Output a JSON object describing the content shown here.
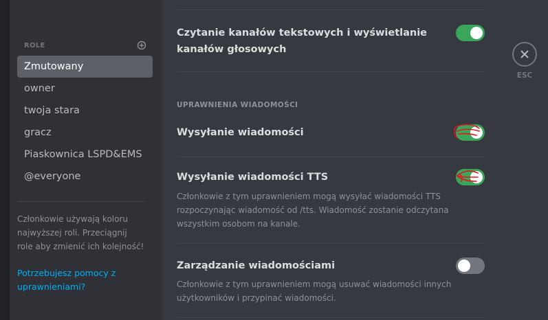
{
  "sidebar": {
    "roles_title": "ROLE",
    "add_role_icon": "plus-circle-icon",
    "roles": [
      {
        "label": "Zmutowany",
        "selected": true
      },
      {
        "label": "owner"
      },
      {
        "label": "twoja stara"
      },
      {
        "label": "gracz"
      },
      {
        "label": "Piaskownica LSPD&EMS"
      },
      {
        "label": "@everyone"
      }
    ],
    "note": "Członkowie używają koloru najwyższej roli. Przeciągnij role aby zmienić ich kolejność!",
    "help_link": "Potrzebujesz pomocy z uprawnieniami?"
  },
  "permissions": {
    "read_channels": {
      "title": "Czytanie kanałów tekstowych i wyświetlanie kanałów głosowych",
      "enabled": true
    },
    "section_messages": "UPRAWNIENIA WIADOMOŚCI",
    "send_messages": {
      "title": "Wysyłanie wiadomości",
      "enabled": true
    },
    "send_tts": {
      "title": "Wysyłanie wiadomości TTS",
      "description": "Członkowie z tym uprawnieniem mogą wysyłać wiadomości TTS rozpoczynając wiadomość od /tts. Wiadomość zostanie odczytana wszystkim osobom na kanale.",
      "enabled": true
    },
    "manage_messages": {
      "title": "Zarządzanie wiadomościami",
      "description": "Członkowie z tym uprawnieniem mogą usuwać wiadomości innych użytkowników i przypinać wiadomości.",
      "enabled": false
    }
  },
  "close": {
    "icon": "close-icon",
    "label": "ESC"
  },
  "colors": {
    "toggle_on": "#3ba55c",
    "toggle_off": "#72767d",
    "link": "#00b0f4",
    "annotation": "#e8141b"
  }
}
